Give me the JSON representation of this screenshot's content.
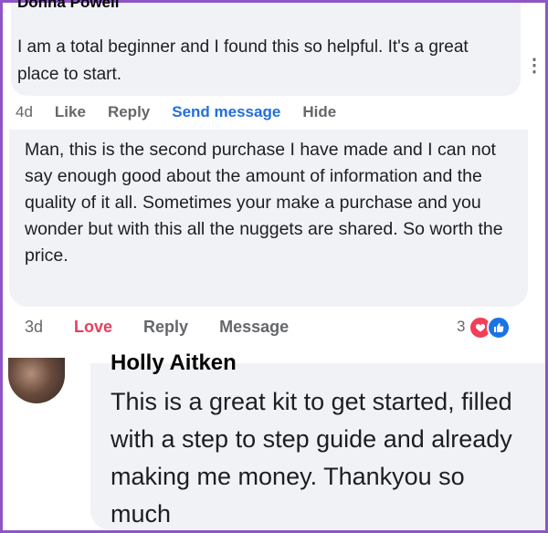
{
  "comments": [
    {
      "name": "Donna Powell",
      "text": "I am a total beginner and I found this so helpful. It's a great place to start.",
      "time": "4d",
      "actions": [
        "Like",
        "Reply",
        "Send message",
        "Hide"
      ]
    },
    {
      "text": "Man, this is the second purchase I have made and I can not say enough good about the amount of information and the quality of it all. Sometimes your make a purchase and you wonder but with this all the nuggets are shared. So worth the price.",
      "time": "3d",
      "actions": [
        "Love",
        "Reply",
        "Message"
      ],
      "reaction_count": "3"
    },
    {
      "name": "Holly Aitken",
      "text": "This is a great kit to get started, filled with a step to step guide and already making me money. Thankyou so much"
    }
  ],
  "colors": {
    "frame": "#8d55c6",
    "bubble": "#f0f2f5",
    "link_blue": "#216fdb",
    "love_red": "#e4405f"
  },
  "icons": [
    "more-options-icon",
    "heart-reaction-icon",
    "like-reaction-icon"
  ]
}
